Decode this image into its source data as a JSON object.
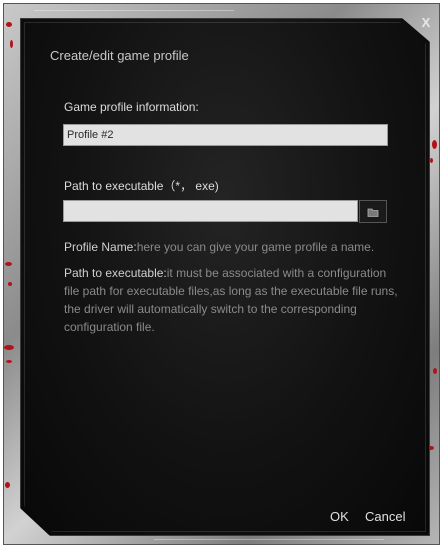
{
  "window": {
    "title": "Create/edit game profile",
    "close_label": "X"
  },
  "profile_info": {
    "label": "Game profile information:",
    "value": "Profile #2"
  },
  "executable": {
    "label": "Path to executable（*， exe)",
    "value": ""
  },
  "help": {
    "profile_name_key": "Profile Name:",
    "profile_name_text": "here you can give your game profile a name.",
    "path_key": "Path to executable:",
    "path_text": "it must be associated with a configuration file path for executable files,as long as the executable file runs, the driver will automatically switch to the corresponding configuration file."
  },
  "buttons": {
    "ok": "OK",
    "cancel": "Cancel"
  },
  "colors": {
    "accent_red": "#b3121b",
    "panel": "#121212"
  },
  "icons": {
    "browse": "folder-icon"
  }
}
